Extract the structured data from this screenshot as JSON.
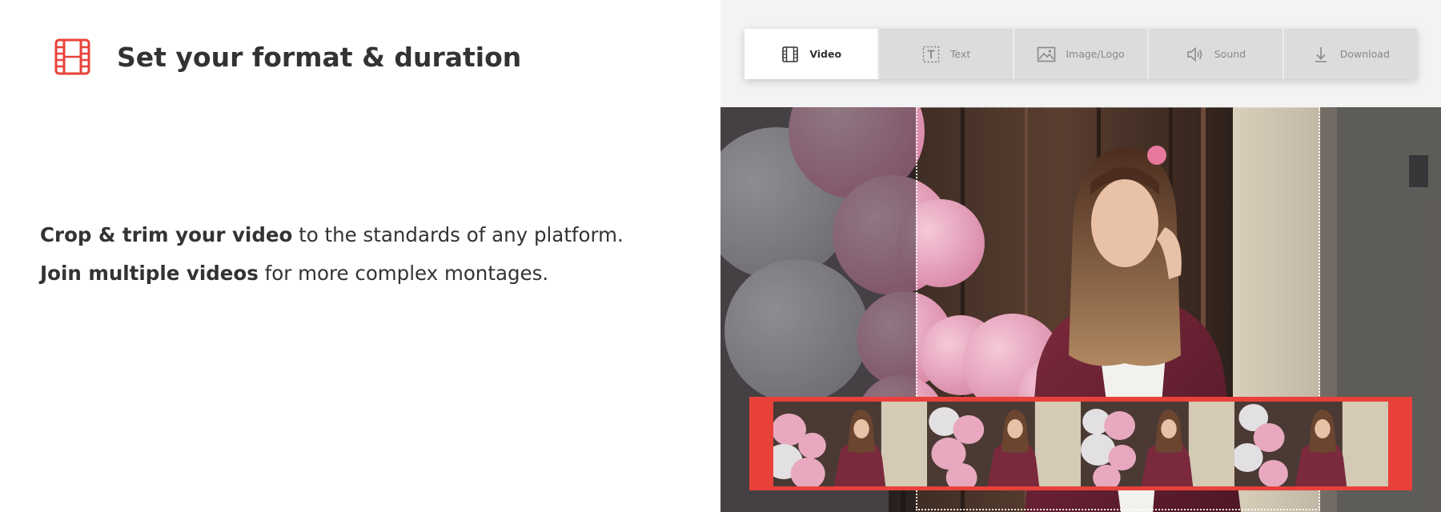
{
  "feature": {
    "title": "Set your format & duration",
    "icon": "film-icon"
  },
  "description": {
    "line1_bold": "Crop & trim your video",
    "line1_rest": " to the standards of any platform.",
    "line2_bold": "Join multiple videos",
    "line2_rest": " for more complex montages."
  },
  "toolbar": {
    "tabs": [
      {
        "label": "Video",
        "icon": "film-icon",
        "active": true
      },
      {
        "label": "Text",
        "icon": "text-icon",
        "active": false
      },
      {
        "label": "Image/Logo",
        "icon": "image-icon",
        "active": false
      },
      {
        "label": "Sound",
        "icon": "speaker-icon",
        "active": false
      },
      {
        "label": "Download",
        "icon": "download-icon",
        "active": false
      }
    ]
  },
  "colors": {
    "accent": "#e8413a",
    "text": "#333333",
    "tab_inactive": "#dcdcdc",
    "tab_active": "#ffffff"
  }
}
